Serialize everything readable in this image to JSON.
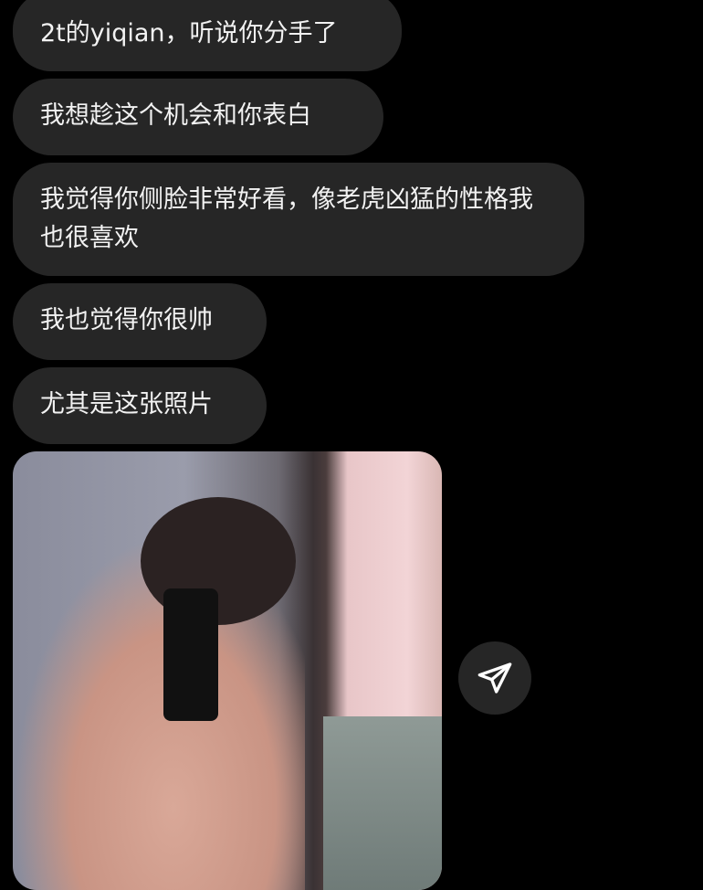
{
  "messages": [
    {
      "text": "2t的yiqian，听说你分手了"
    },
    {
      "text": "我想趁这个机会和你表白"
    },
    {
      "text": "我觉得你侧脸非常好看，像老虎凶猛的性格我也很喜欢"
    },
    {
      "text": "我也觉得你很帅"
    },
    {
      "text": "尤其是这张照片"
    }
  ],
  "colors": {
    "background": "#000000",
    "bubble": "#262626",
    "text": "#f2f2f2"
  },
  "share_button": {
    "icon": "paper-plane-icon"
  }
}
